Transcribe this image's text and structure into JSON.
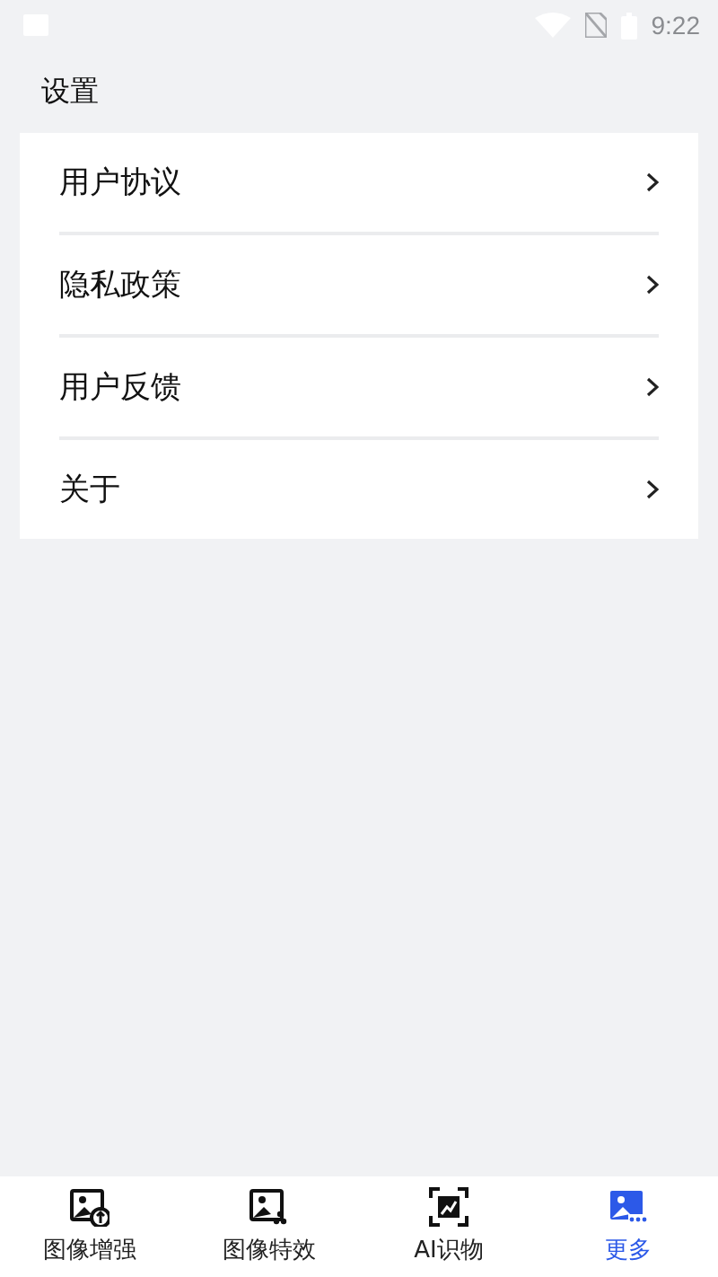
{
  "status_bar": {
    "time": "9:22"
  },
  "title": "设置",
  "menu": [
    {
      "label": "用户协议"
    },
    {
      "label": "隐私政策"
    },
    {
      "label": "用户反馈"
    },
    {
      "label": "关于"
    }
  ],
  "tabs": [
    {
      "label": "图像增强",
      "kind": "enhance",
      "selected": false
    },
    {
      "label": "图像特效",
      "kind": "effects",
      "selected": false
    },
    {
      "label": "AI识物",
      "kind": "scan",
      "selected": false
    },
    {
      "label": "更多",
      "kind": "more",
      "selected": true
    }
  ]
}
